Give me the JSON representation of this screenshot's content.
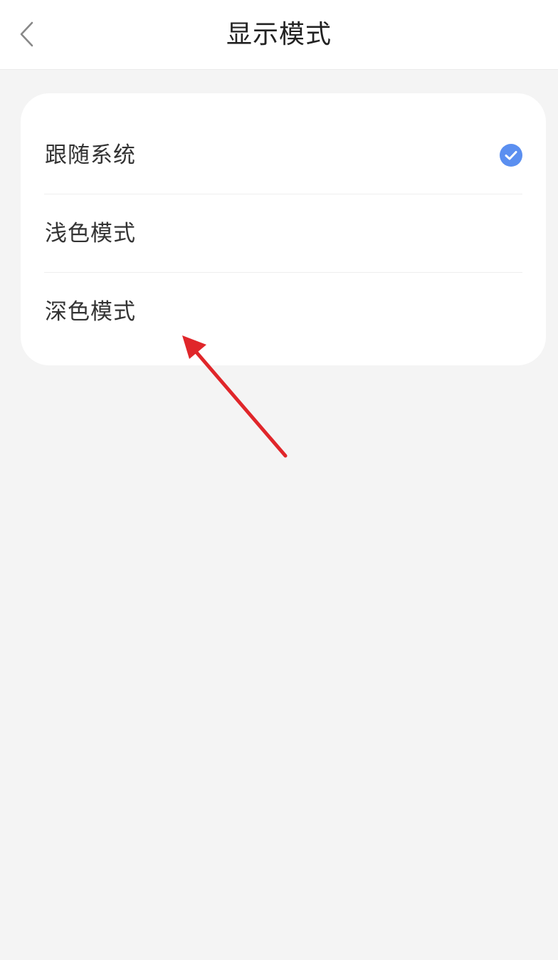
{
  "header": {
    "title": "显示模式",
    "back_icon": "chevron-left-icon"
  },
  "options": [
    {
      "label": "跟随系统",
      "selected": true
    },
    {
      "label": "浅色模式",
      "selected": false
    },
    {
      "label": "深色模式",
      "selected": false
    }
  ],
  "colors": {
    "accent": "#5b8ff0",
    "annotation_arrow": "#e0262a",
    "background": "#f4f4f4",
    "card": "#ffffff"
  }
}
